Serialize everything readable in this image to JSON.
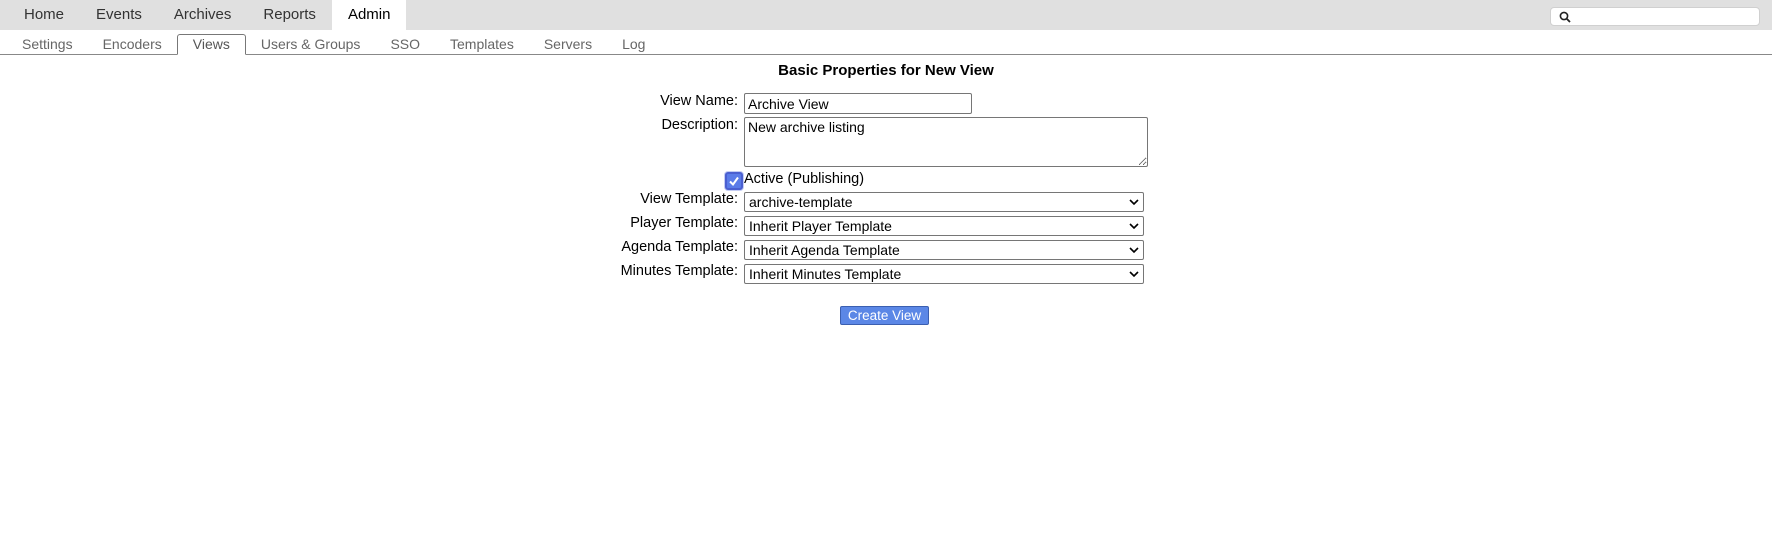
{
  "topnav": {
    "items": [
      {
        "label": "Home"
      },
      {
        "label": "Events"
      },
      {
        "label": "Archives"
      },
      {
        "label": "Reports"
      },
      {
        "label": "Admin",
        "active": true
      }
    ],
    "search_placeholder": ""
  },
  "subnav": {
    "tabs": [
      {
        "label": "Settings"
      },
      {
        "label": "Encoders"
      },
      {
        "label": "Views",
        "active": true
      },
      {
        "label": "Users & Groups"
      },
      {
        "label": "SSO"
      },
      {
        "label": "Templates"
      },
      {
        "label": "Servers"
      },
      {
        "label": "Log"
      }
    ]
  },
  "form": {
    "title": "Basic Properties for New View",
    "view_name_label": "View Name:",
    "view_name_value": "Archive View",
    "description_label": "Description:",
    "description_value": "New archive listing",
    "active_label": "Active (Publishing)",
    "active_checked": true,
    "view_template_label": "View Template:",
    "view_template_value": "archive-template",
    "player_template_label": "Player Template:",
    "player_template_value": "Inherit Player Template",
    "agenda_template_label": "Agenda Template:",
    "agenda_template_value": "Inherit Agenda Template",
    "minutes_template_label": "Minutes Template:",
    "minutes_template_value": "Inherit Minutes Template",
    "submit_label": "Create View"
  },
  "colors": {
    "topbar_bg": "#e0e0e0",
    "button_bg": "#5b87e6",
    "checkbox_accent": "#4a5fd0"
  }
}
